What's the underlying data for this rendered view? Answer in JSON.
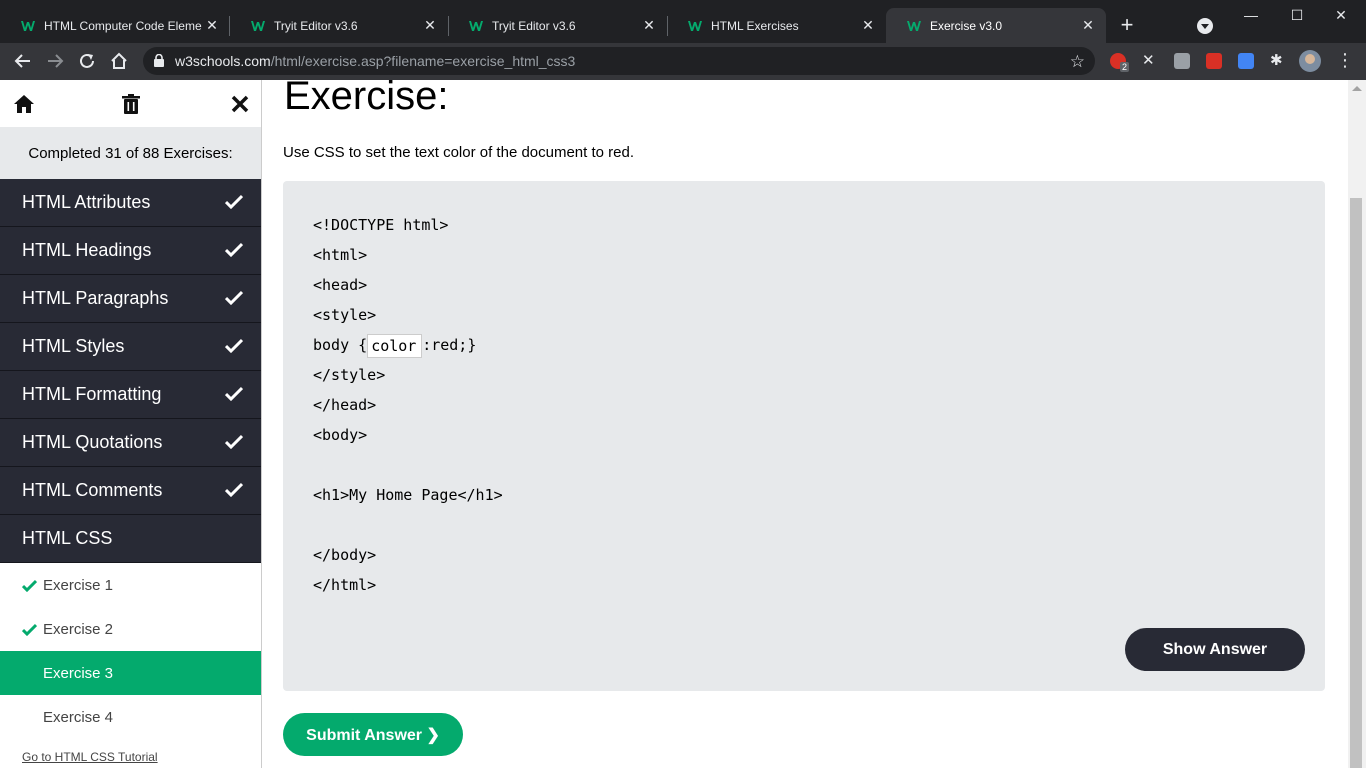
{
  "browser": {
    "tabs": [
      {
        "title": "HTML Computer Code Eleme"
      },
      {
        "title": "Tryit Editor v3.6"
      },
      {
        "title": "Tryit Editor v3.6"
      },
      {
        "title": "HTML Exercises"
      },
      {
        "title": "Exercise v3.0"
      }
    ],
    "url_host": "w3schools.com",
    "url_path": "/html/exercise.asp?filename=exercise_html_css3",
    "extension_badge": "2",
    "colors": {
      "tabstrip": "#202124",
      "toolbar": "#35363a",
      "w3_green": "#04aa6d"
    }
  },
  "sidebar": {
    "completed": "Completed 31 of 88 Exercises:",
    "categories": [
      {
        "label": "HTML Attributes",
        "done": true
      },
      {
        "label": "HTML Headings",
        "done": true
      },
      {
        "label": "HTML Paragraphs",
        "done": true
      },
      {
        "label": "HTML Styles",
        "done": true
      },
      {
        "label": "HTML Formatting",
        "done": true
      },
      {
        "label": "HTML Quotations",
        "done": true
      },
      {
        "label": "HTML Comments",
        "done": true
      },
      {
        "label": "HTML CSS",
        "done": false
      }
    ],
    "exercises": [
      {
        "label": "Exercise 1",
        "done": true
      },
      {
        "label": "Exercise 2",
        "done": true
      },
      {
        "label": "Exercise 3",
        "active": true
      },
      {
        "label": "Exercise 4"
      }
    ],
    "tutorial_link": "Go to HTML CSS Tutorial"
  },
  "main": {
    "title": "Exercise:",
    "instruction": "Use CSS to set the text color of the document to red.",
    "code": {
      "line1": "<!DOCTYPE html>",
      "line2": "<html>",
      "line3": "<head>",
      "line4": "<style>",
      "line5_before": "body {",
      "line5_input": "color",
      "line5_after": ":red;}",
      "line6": "</style>",
      "line7": "</head>",
      "line8": "<body>",
      "line9": "",
      "line10": "<h1>My Home Page</h1>",
      "line11": "",
      "line12": "</body>",
      "line13": "</html>"
    },
    "show_answer": "Show Answer",
    "submit": "Submit Answer ❯"
  }
}
